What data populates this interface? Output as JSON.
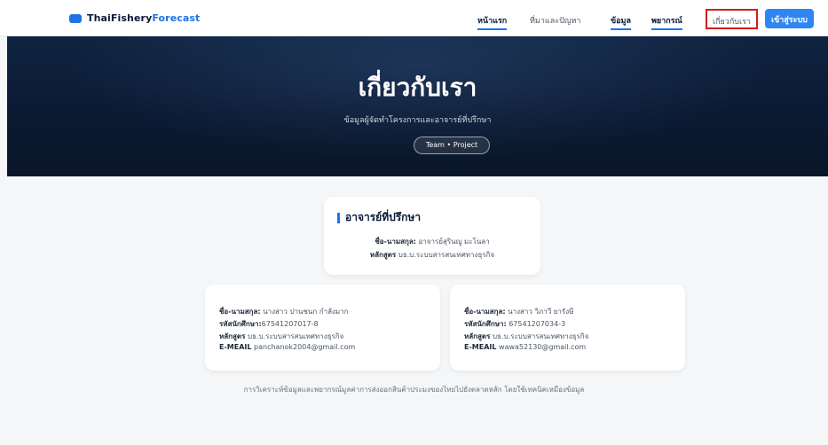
{
  "brand": {
    "name_primary": "ThaiFishery",
    "name_accent": "Forecast",
    "icon": "logo-icon"
  },
  "nav": {
    "items": [
      {
        "label": "หน้าแรก",
        "active": true
      },
      {
        "label": "ที่มาและปัญหา",
        "active": false
      },
      {
        "label": "ข้อมูล",
        "active": true
      },
      {
        "label": "พยากรณ์",
        "active": true
      },
      {
        "label": "เกี่ยวกับเรา",
        "active": false,
        "highlighted": true
      }
    ],
    "login_label": "เข้าสู่ระบบ"
  },
  "hero": {
    "title": "เกี่ยวกับเรา",
    "subtitle": "ข้อมูลผู้จัดทำโครงการและอาจารย์ที่ปรึกษา",
    "pill": "Team • Project"
  },
  "advisor": {
    "title": "อาจารย์ที่ปรึกษา",
    "name_label": "ชื่อ-นามสกุล:",
    "name_value": "อาจารย์สุรินญู มะโนลา",
    "program_label": "หลักสูตร",
    "program_value": "บธ.บ.ระบบสารสนเทศทางธุรกิจ"
  },
  "members": [
    {
      "name_label": "ชื่อ-นามสกุล:",
      "name_value": "นางสาว ปานชนก กำลังมาก",
      "id_label": "รหัสนักศึกษา:",
      "id_value": "67541207017-8",
      "program_label": "หลักสูตร",
      "program_value": "บธ.บ.ระบบสารสนเทศทางธุรกิจ",
      "email_label": "E-MEAIL",
      "email_value": "panchanok2004@gmail.com"
    },
    {
      "name_label": "ชื่อ-นามสกุล:",
      "name_value": "นางสาว วิภาวี ยารังษี",
      "id_label": "รหัสนักศึกษา:",
      "id_value": "67541207034-3",
      "program_label": "หลักสูตร",
      "program_value": "บธ.บ.ระบบสารสนเทศทางธุรกิจ",
      "email_label": "E-MEAIL",
      "email_value": "wawa52130@gmail.com"
    }
  ],
  "footer": {
    "note": "การวิเคราะห์ข้อมูลและพยากรณ์มูลค่าการส่งออกสินค้าประมงของไทยไปยังตลาดหลัก โดยใช้เทคนิคเหมืองข้อมูล"
  },
  "colors": {
    "accent": "#1e73e8",
    "hero_bg": "#0b1a33",
    "highlight_border": "#d61b1b",
    "login_bg": "#2f86f2"
  }
}
